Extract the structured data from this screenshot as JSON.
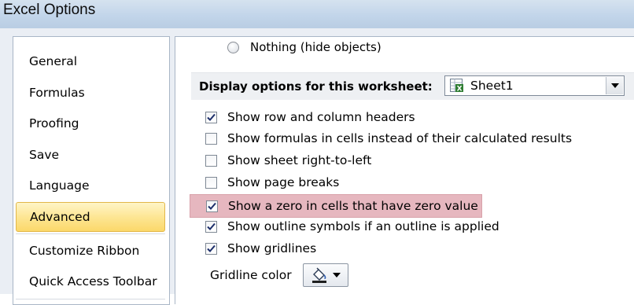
{
  "window": {
    "title": "Excel Options"
  },
  "nav": {
    "items": [
      {
        "label": "General",
        "selected": false
      },
      {
        "label": "Formulas",
        "selected": false
      },
      {
        "label": "Proofing",
        "selected": false
      },
      {
        "label": "Save",
        "selected": false
      },
      {
        "label": "Language",
        "selected": false
      },
      {
        "label": "Advanced",
        "selected": true
      },
      {
        "label": "Customize Ribbon",
        "selected": false
      },
      {
        "label": "Quick Access Toolbar",
        "selected": false
      }
    ]
  },
  "objects": {
    "nothing_label": "Nothing (hide objects)",
    "nothing_selected": false
  },
  "worksheet_section": {
    "label": "Display options for this worksheet:",
    "selected_sheet": "Sheet1"
  },
  "options": [
    {
      "label": "Show row and column headers",
      "checked": true,
      "highlighted": false
    },
    {
      "label": "Show formulas in cells instead of their calculated results",
      "checked": false,
      "highlighted": false
    },
    {
      "label": "Show sheet right-to-left",
      "checked": false,
      "highlighted": false
    },
    {
      "label": "Show page breaks",
      "checked": false,
      "highlighted": false
    },
    {
      "label": "Show a zero in cells that have zero value",
      "checked": true,
      "highlighted": true
    },
    {
      "label": "Show outline symbols if an outline is applied",
      "checked": true,
      "highlighted": false
    },
    {
      "label": "Show gridlines",
      "checked": true,
      "highlighted": false
    }
  ],
  "gridline": {
    "label": "Gridline color"
  },
  "colors": {
    "highlight": "#e6b7bf",
    "nav_selected": "#fde694",
    "checkmark": "#1d2f6b"
  }
}
